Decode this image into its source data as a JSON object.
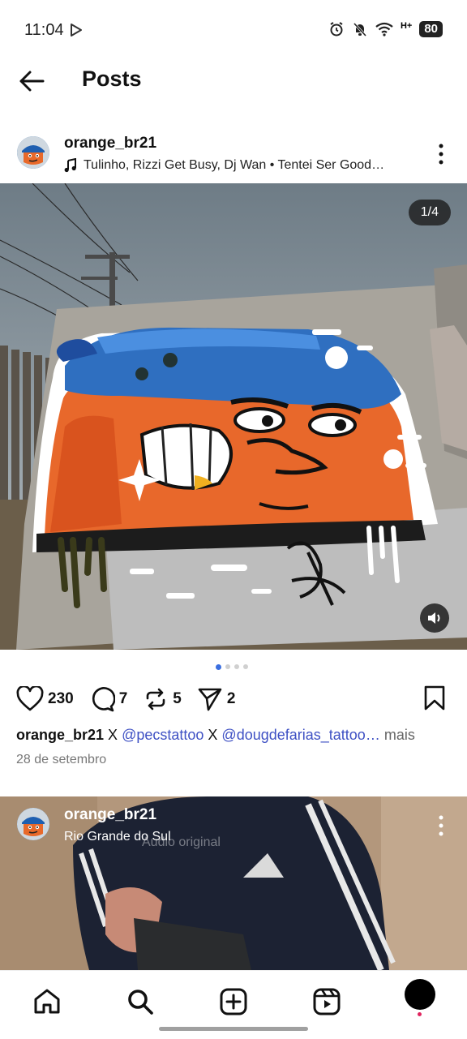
{
  "status_bar": {
    "time": "11:04",
    "network": "H+",
    "battery": "80"
  },
  "header": {
    "title": "Posts"
  },
  "post1": {
    "username": "orange_br21",
    "music": "Tulinho, Rizzi Get Busy, Dj Wan • Tentei Ser Good…",
    "counter": "1/4",
    "carousel": {
      "total": 4,
      "active": 0
    },
    "likes": "230",
    "comments": "7",
    "reposts": "5",
    "shares": "2",
    "caption": {
      "user": "orange_br21",
      "sep1": " X ",
      "mention1": "@pecstattoo",
      "sep2": " X ",
      "mention2": "@dougdefarias_tattoo…",
      "more": " mais"
    },
    "date": "28 de setembro"
  },
  "post2": {
    "username": "orange_br21",
    "location": "Rio Grande do Sul",
    "overlay_text": "Áudio original"
  },
  "icons": {
    "back": "arrow-left-icon",
    "more": "more-vertical-icon",
    "music": "music-note-icon",
    "like": "heart-icon",
    "comment": "comment-icon",
    "repost": "repost-icon",
    "share": "send-icon",
    "save": "bookmark-icon",
    "sound": "speaker-icon",
    "nav": [
      "home-icon",
      "search-icon",
      "create-icon",
      "reels-icon",
      "profile-avatar"
    ]
  },
  "colors": {
    "mention": "#3f51c4",
    "active_dot": "#3b6fe0",
    "notification": "#e0245e"
  }
}
